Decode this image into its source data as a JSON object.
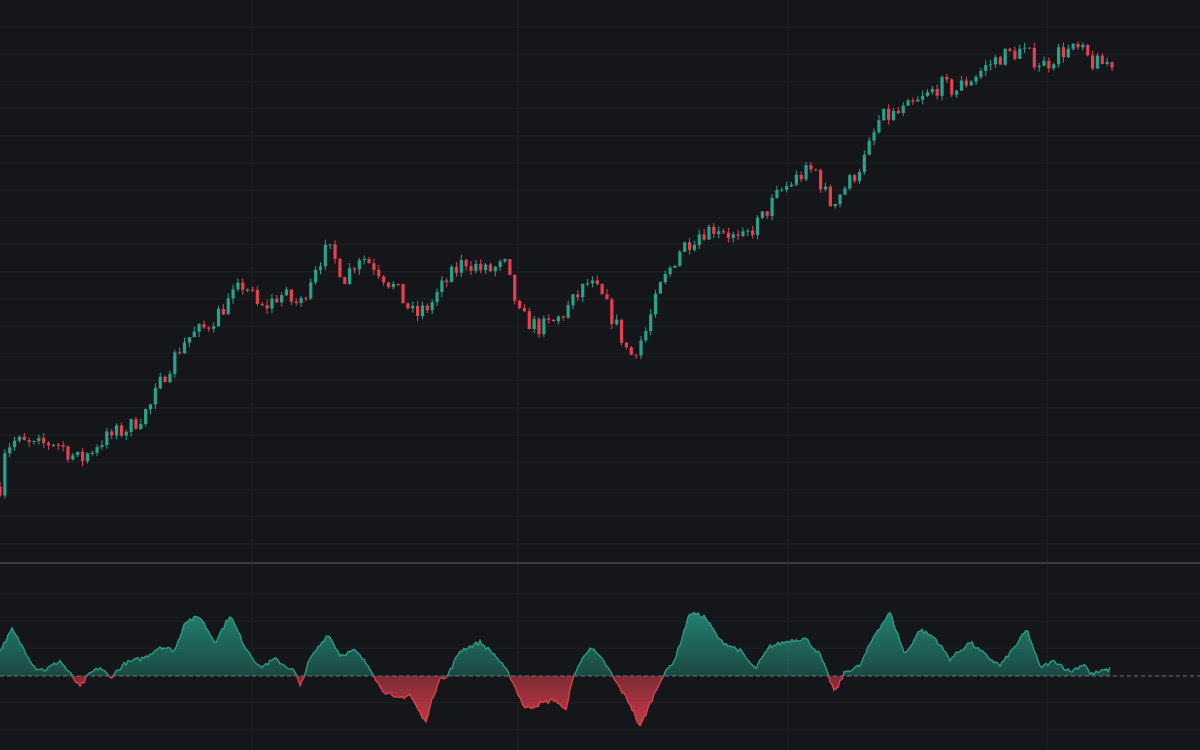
{
  "theme": {
    "background": "#151619",
    "grid_color": "#1f2024",
    "separator_color": "#3a3b40",
    "up_color": "#26a38c",
    "down_color": "#e5404e",
    "baseline_color": "#6b6d74"
  },
  "chart_data": [
    {
      "type": "candlestick",
      "title": "",
      "grid": true,
      "x_axis_labels": false,
      "y_axis_labels": false,
      "ylim": [
        1.6,
        11.5
      ],
      "price_path": [
        [
          0,
          2.9
        ],
        [
          5,
          3.6
        ],
        [
          15,
          3.7
        ],
        [
          35,
          3.6
        ],
        [
          55,
          3.7
        ],
        [
          80,
          3.35
        ],
        [
          100,
          3.7
        ],
        [
          130,
          3.95
        ],
        [
          150,
          4.3
        ],
        [
          165,
          4.9
        ],
        [
          185,
          5.5
        ],
        [
          205,
          5.7
        ],
        [
          230,
          6.2
        ],
        [
          245,
          6.5
        ],
        [
          260,
          6.0
        ],
        [
          280,
          6.3
        ],
        [
          300,
          6.1
        ],
        [
          315,
          6.8
        ],
        [
          328,
          7.1
        ],
        [
          345,
          6.6
        ],
        [
          360,
          7.0
        ],
        [
          375,
          6.8
        ],
        [
          395,
          6.4
        ],
        [
          415,
          5.9
        ],
        [
          430,
          6.1
        ],
        [
          445,
          6.5
        ],
        [
          465,
          6.9
        ],
        [
          485,
          6.7
        ],
        [
          505,
          6.8
        ],
        [
          520,
          5.9
        ],
        [
          540,
          5.7
        ],
        [
          555,
          5.8
        ],
        [
          570,
          6.1
        ],
        [
          588,
          6.5
        ],
        [
          600,
          6.3
        ],
        [
          615,
          5.8
        ],
        [
          630,
          5.2
        ],
        [
          645,
          5.6
        ],
        [
          660,
          6.4
        ],
        [
          680,
          7.1
        ],
        [
          700,
          7.4
        ],
        [
          720,
          7.5
        ],
        [
          740,
          7.2
        ],
        [
          760,
          7.6
        ],
        [
          780,
          8.1
        ],
        [
          800,
          8.4
        ],
        [
          815,
          8.5
        ],
        [
          830,
          7.9
        ],
        [
          850,
          8.3
        ],
        [
          865,
          8.7
        ],
        [
          880,
          9.4
        ],
        [
          900,
          9.5
        ],
        [
          920,
          9.7
        ],
        [
          940,
          10.0
        ],
        [
          955,
          9.9
        ],
        [
          970,
          10.1
        ],
        [
          985,
          10.3
        ],
        [
          1000,
          10.5
        ],
        [
          1020,
          10.6
        ],
        [
          1045,
          10.35
        ],
        [
          1060,
          10.6
        ],
        [
          1080,
          10.6
        ],
        [
          1095,
          10.35
        ],
        [
          1110,
          10.4
        ]
      ],
      "candle_count": 230,
      "x_range": [
        0,
        1112
      ],
      "volatility": 0.16
    },
    {
      "type": "area",
      "title": "",
      "baseline_value": 0,
      "ylim": [
        -0.6,
        0.9
      ],
      "dashed_baseline": true,
      "oscillator_path": [
        [
          0,
          0.3
        ],
        [
          12,
          0.55
        ],
        [
          25,
          0.3
        ],
        [
          35,
          0.1
        ],
        [
          45,
          0.07
        ],
        [
          60,
          0.18
        ],
        [
          75,
          -0.05
        ],
        [
          80,
          -0.12
        ],
        [
          90,
          0.03
        ],
        [
          100,
          0.1
        ],
        [
          110,
          -0.02
        ],
        [
          125,
          0.15
        ],
        [
          145,
          0.22
        ],
        [
          160,
          0.35
        ],
        [
          175,
          0.3
        ],
        [
          185,
          0.65
        ],
        [
          200,
          0.7
        ],
        [
          215,
          0.4
        ],
        [
          230,
          0.72
        ],
        [
          245,
          0.35
        ],
        [
          260,
          0.1
        ],
        [
          275,
          0.2
        ],
        [
          295,
          0.05
        ],
        [
          300,
          -0.12
        ],
        [
          310,
          0.2
        ],
        [
          328,
          0.5
        ],
        [
          340,
          0.25
        ],
        [
          355,
          0.3
        ],
        [
          370,
          0.1
        ],
        [
          380,
          -0.12
        ],
        [
          395,
          -0.25
        ],
        [
          410,
          -0.2
        ],
        [
          425,
          -0.5
        ],
        [
          440,
          0.0
        ],
        [
          445,
          -0.05
        ],
        [
          460,
          0.3
        ],
        [
          480,
          0.4
        ],
        [
          495,
          0.25
        ],
        [
          510,
          0.0
        ],
        [
          525,
          -0.35
        ],
        [
          540,
          -0.3
        ],
        [
          555,
          -0.25
        ],
        [
          565,
          -0.38
        ],
        [
          575,
          0.05
        ],
        [
          590,
          0.35
        ],
        [
          605,
          0.15
        ],
        [
          615,
          -0.05
        ],
        [
          630,
          -0.3
        ],
        [
          640,
          -0.55
        ],
        [
          650,
          -0.3
        ],
        [
          660,
          -0.05
        ],
        [
          675,
          0.2
        ],
        [
          690,
          0.75
        ],
        [
          705,
          0.7
        ],
        [
          720,
          0.42
        ],
        [
          740,
          0.3
        ],
        [
          755,
          0.08
        ],
        [
          770,
          0.35
        ],
        [
          790,
          0.42
        ],
        [
          805,
          0.45
        ],
        [
          820,
          0.25
        ],
        [
          830,
          -0.05
        ],
        [
          835,
          -0.18
        ],
        [
          845,
          0.05
        ],
        [
          860,
          0.12
        ],
        [
          875,
          0.5
        ],
        [
          890,
          0.75
        ],
        [
          905,
          0.25
        ],
        [
          920,
          0.55
        ],
        [
          935,
          0.45
        ],
        [
          950,
          0.2
        ],
        [
          970,
          0.4
        ],
        [
          985,
          0.25
        ],
        [
          1000,
          0.12
        ],
        [
          1015,
          0.35
        ],
        [
          1027,
          0.55
        ],
        [
          1040,
          0.1
        ],
        [
          1055,
          0.18
        ],
        [
          1070,
          0.05
        ],
        [
          1085,
          0.15
        ],
        [
          1090,
          0.02
        ],
        [
          1110,
          0.08
        ]
      ]
    }
  ]
}
